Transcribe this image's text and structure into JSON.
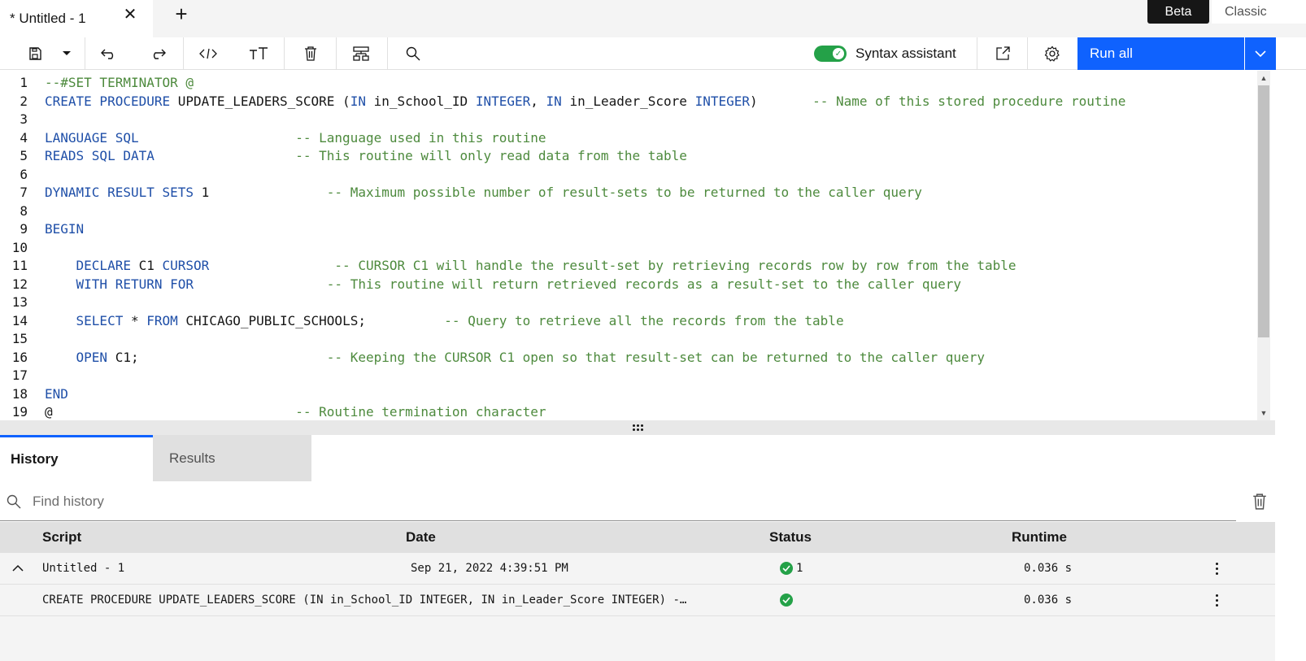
{
  "tab": {
    "title": "* Untitled - 1"
  },
  "mode": {
    "beta": "Beta",
    "classic": "Classic"
  },
  "toolbar": {
    "syntax_assistant_label": "Syntax assistant",
    "syntax_assistant_on": true,
    "run_all_label": "Run all"
  },
  "editor": {
    "line_numbers": [
      "1",
      "2",
      "3",
      "4",
      "5",
      "6",
      "7",
      "8",
      "9",
      "10",
      "11",
      "12",
      "13",
      "14",
      "15",
      "16",
      "17",
      "18",
      "19"
    ],
    "lines": [
      [
        {
          "t": "--#SET TERMINATOR @",
          "c": "cm"
        }
      ],
      [
        {
          "t": "CREATE PROCEDURE ",
          "c": "kw"
        },
        {
          "t": "UPDATE_LEADERS_SCORE (",
          "c": ""
        },
        {
          "t": "IN ",
          "c": "kw"
        },
        {
          "t": "in_School_ID ",
          "c": ""
        },
        {
          "t": "INTEGER",
          "c": "kw"
        },
        {
          "t": ", ",
          "c": ""
        },
        {
          "t": "IN ",
          "c": "kw"
        },
        {
          "t": "in_Leader_Score ",
          "c": ""
        },
        {
          "t": "INTEGER",
          "c": "kw"
        },
        {
          "t": ")       ",
          "c": ""
        },
        {
          "t": "-- Name of this stored procedure routine",
          "c": "cm"
        }
      ],
      [],
      [
        {
          "t": "LANGUAGE SQL",
          "c": "kw"
        },
        {
          "t": "                    ",
          "c": ""
        },
        {
          "t": "-- Language used in this routine",
          "c": "cm"
        }
      ],
      [
        {
          "t": "READS SQL DATA",
          "c": "kw"
        },
        {
          "t": "                  ",
          "c": ""
        },
        {
          "t": "-- This routine will only read data from the table",
          "c": "cm"
        }
      ],
      [],
      [
        {
          "t": "DYNAMIC RESULT SETS ",
          "c": "kw"
        },
        {
          "t": "1",
          "c": ""
        },
        {
          "t": "               ",
          "c": ""
        },
        {
          "t": "-- Maximum possible number of result-sets to be returned to the caller query",
          "c": "cm"
        }
      ],
      [],
      [
        {
          "t": "BEGIN",
          "c": "kw"
        }
      ],
      [],
      [
        {
          "t": "    ",
          "c": ""
        },
        {
          "t": "DECLARE ",
          "c": "kw"
        },
        {
          "t": "C1 ",
          "c": ""
        },
        {
          "t": "CURSOR",
          "c": "kw"
        },
        {
          "t": "                ",
          "c": ""
        },
        {
          "t": "-- CURSOR C1 will handle the result-set by retrieving records row by row from the table",
          "c": "cm"
        }
      ],
      [
        {
          "t": "    ",
          "c": ""
        },
        {
          "t": "WITH RETURN FOR",
          "c": "kw"
        },
        {
          "t": "                 ",
          "c": ""
        },
        {
          "t": "-- This routine will return retrieved records as a result-set to the caller query",
          "c": "cm"
        }
      ],
      [],
      [
        {
          "t": "    ",
          "c": ""
        },
        {
          "t": "SELECT ",
          "c": "kw"
        },
        {
          "t": "* ",
          "c": ""
        },
        {
          "t": "FROM ",
          "c": "kw"
        },
        {
          "t": "CHICAGO_PUBLIC_SCHOOLS;",
          "c": ""
        },
        {
          "t": "          ",
          "c": ""
        },
        {
          "t": "-- Query to retrieve all the records from the table",
          "c": "cm"
        }
      ],
      [],
      [
        {
          "t": "    ",
          "c": ""
        },
        {
          "t": "OPEN ",
          "c": "kw"
        },
        {
          "t": "C1;",
          "c": ""
        },
        {
          "t": "                        ",
          "c": ""
        },
        {
          "t": "-- Keeping the CURSOR C1 open so that result-set can be returned to the caller query",
          "c": "cm"
        }
      ],
      [],
      [
        {
          "t": "END",
          "c": "kw"
        }
      ],
      [
        {
          "t": "@",
          "c": ""
        },
        {
          "t": "                               ",
          "c": ""
        },
        {
          "t": "-- Routine termination character",
          "c": "cm"
        }
      ]
    ]
  },
  "bottom_tabs": {
    "history": "History",
    "results": "Results"
  },
  "history": {
    "search_placeholder": "Find history",
    "columns": {
      "script": "Script",
      "date": "Date",
      "status": "Status",
      "runtime": "Runtime"
    },
    "rows": [
      {
        "script": "Untitled - 1",
        "date": "Sep 21, 2022 4:39:51 PM",
        "status_count": "1",
        "runtime": "0.036 s"
      },
      {
        "script": "CREATE PROCEDURE UPDATE_LEADERS_SCORE (IN in_School_ID INTEGER, IN in_Leader_Score INTEGER) -…",
        "date": "",
        "status_count": "",
        "runtime": "0.036 s"
      }
    ]
  },
  "colors": {
    "accent": "#0f62fe",
    "success": "#24a148",
    "keyword": "#1f4fa8",
    "comment": "#4d8a3d"
  },
  "icons": [
    "save-icon",
    "caret-down-icon",
    "undo-icon",
    "redo-icon",
    "code-icon",
    "text-size-icon",
    "trash-icon",
    "format-icon",
    "search-icon",
    "launch-icon",
    "gear-icon",
    "chevron-down-icon",
    "chevron-up-icon",
    "check-icon",
    "overflow-menu-icon"
  ]
}
